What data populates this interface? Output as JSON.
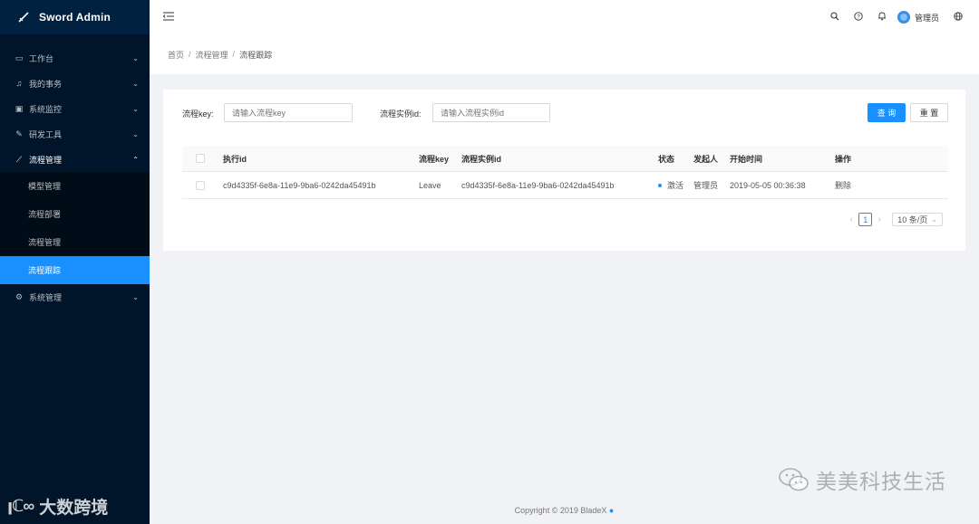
{
  "app": {
    "title": "Sword Admin"
  },
  "sidebar": {
    "items": [
      {
        "label": "工作台",
        "icon": "monitor-icon"
      },
      {
        "label": "我的事务",
        "icon": "bell-icon"
      },
      {
        "label": "系统监控",
        "icon": "chart-icon"
      },
      {
        "label": "研发工具",
        "icon": "wrench-icon"
      },
      {
        "label": "流程管理",
        "icon": "flow-icon"
      },
      {
        "label": "系统管理",
        "icon": "gear-icon"
      }
    ],
    "subitems": [
      "模型管理",
      "流程部署",
      "流程管理",
      "流程跟踪"
    ],
    "watermark": "大数跨境"
  },
  "header": {
    "username": "管理员",
    "icons": [
      "search-icon",
      "help-icon",
      "bell-icon",
      "globe-icon"
    ]
  },
  "breadcrumb": [
    "首页",
    "流程管理",
    "流程跟踪"
  ],
  "search": {
    "key_label": "流程key:",
    "key_placeholder": "请输入流程key",
    "instance_label": "流程实例id:",
    "instance_placeholder": "请输入流程实例id",
    "query_label": "查 询",
    "reset_label": "重 置"
  },
  "table": {
    "headers": [
      "执行id",
      "流程key",
      "流程实例id",
      "状态",
      "发起人",
      "开始时间",
      "操作"
    ],
    "rows": [
      {
        "exec_id": "c9d4335f-6e8a-11e9-9ba6-0242da45491b",
        "process_key": "Leave",
        "instance_id": "c9d4335f-6e8a-11e9-9ba6-0242da45491b",
        "status": "激活",
        "initiator": "管理员",
        "start_time": "2019-05-05 00:36:38",
        "action": "删除"
      }
    ]
  },
  "pagination": {
    "current": "1",
    "page_size": "10 条/页"
  },
  "footer": {
    "copyright": "Copyright © 2019 BladeX"
  },
  "watermark_right": "美美科技生活",
  "colors": {
    "sidebar_bg": "#001529",
    "primary": "#1890ff"
  }
}
